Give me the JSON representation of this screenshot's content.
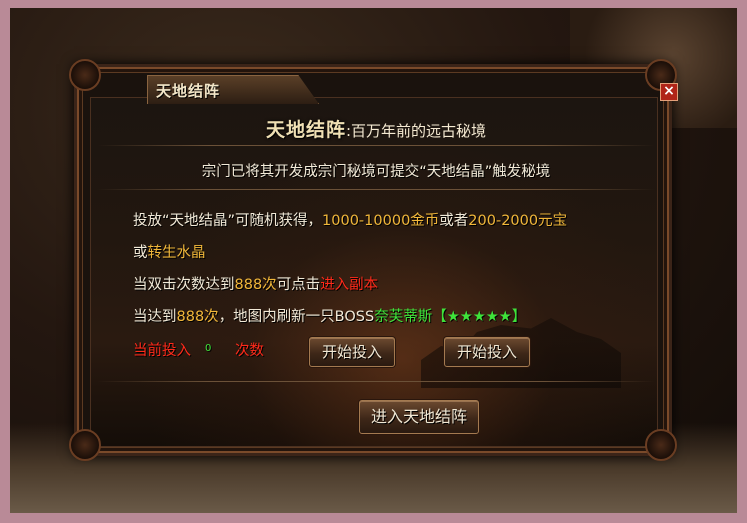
{
  "dialog": {
    "tab_title": "天地结阵",
    "close_label": "×"
  },
  "header": {
    "name": "天地结阵",
    "colon_subtitle": ":百万年前的远古秘境"
  },
  "intro": "宗门已将其开发成宗门秘境可提交“天地结晶”触发秘境",
  "reward": {
    "prefix": "投放“天地结晶”可随机获得，",
    "gold_range": "1000-10000金币",
    "or1": "或者",
    "yuanbao_range": "200-2000元宝",
    "or2": "或",
    "crystal": "转生水晶"
  },
  "double_click": {
    "prefix": "当双击次数达到",
    "count": "888次",
    "middle": "可点击",
    "link": "进入副本"
  },
  "boss_line": {
    "prefix": "当达到",
    "count": "888次",
    "middle": "，地图内刷新一只BOSS",
    "boss_name": "奈芙蒂斯",
    "stars": "【★★★★★】"
  },
  "current": {
    "label": "当前投入",
    "value": "0",
    "suffix": "次数"
  },
  "buttons": {
    "start1": "开始投入",
    "start2": "开始投入",
    "enter": "进入天地结阵"
  }
}
